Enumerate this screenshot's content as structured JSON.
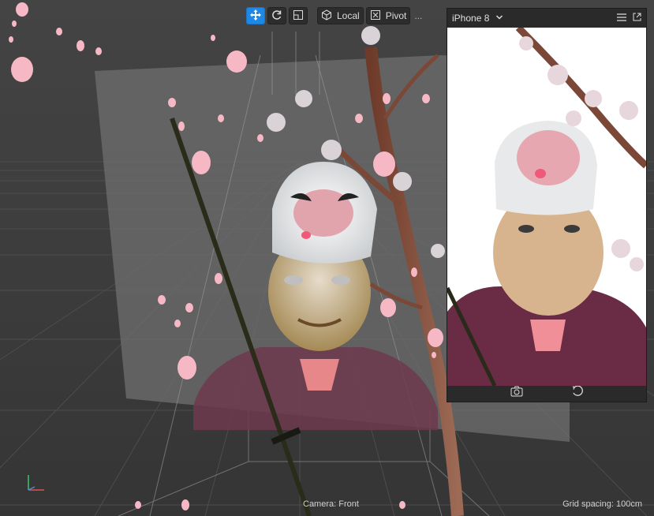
{
  "toolbar": {
    "local_label": "Local",
    "pivot_label": "Pivot",
    "more_label": "..."
  },
  "preview": {
    "device": "iPhone 8"
  },
  "status": {
    "camera": "Camera: Front",
    "grid_spacing": "Grid spacing: 100cm"
  },
  "icons": {
    "move": "move-icon",
    "rotate": "rotate-icon",
    "scale": "scale-icon",
    "local": "cube-icon",
    "pivot": "pivot-icon",
    "device_dropdown": "chevron-down-icon",
    "menu": "menu-icon",
    "popout": "popout-icon",
    "capture": "camera-capture-icon",
    "flip": "flip-camera-icon"
  },
  "colors": {
    "accent": "#1e88e5",
    "viewport_bg": "#3b3b3b",
    "panel_bg": "#2a2a2a"
  }
}
